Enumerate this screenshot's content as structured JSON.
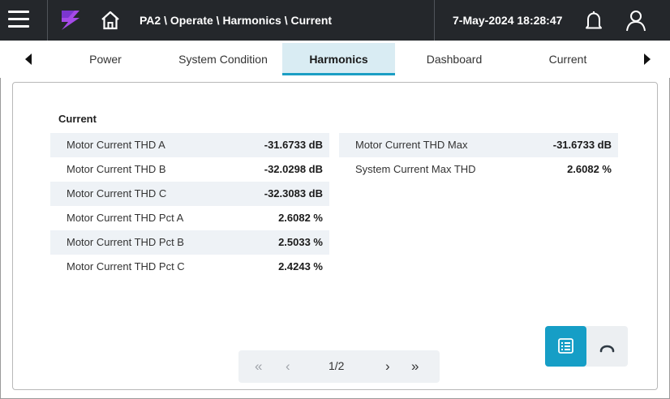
{
  "header": {
    "breadcrumb": "PA2 \\ Operate \\ Harmonics \\ Current",
    "datetime": "7-May-2024 18:28:47",
    "icons": [
      "menu-icon",
      "logo-icon",
      "home-icon",
      "bell-icon",
      "user-icon"
    ],
    "colors": {
      "background": "#24272b",
      "logo": "#a54ae8"
    }
  },
  "tabs": {
    "items": [
      {
        "label": "Power"
      },
      {
        "label": "System Condition"
      },
      {
        "label": "Harmonics"
      },
      {
        "label": "Dashboard"
      },
      {
        "label": "Current"
      }
    ],
    "active": "Harmonics",
    "accent": "#1b9ec4"
  },
  "content": {
    "section_title": "Current",
    "left_rows": [
      {
        "label": "Motor Current THD A",
        "value": "-31.6733 dB"
      },
      {
        "label": "Motor Current THD B",
        "value": "-32.0298 dB"
      },
      {
        "label": "Motor Current THD C",
        "value": "-32.3083 dB"
      },
      {
        "label": "Motor Current THD Pct A",
        "value": "2.6082 %"
      },
      {
        "label": "Motor Current THD Pct B",
        "value": "2.5033 %"
      },
      {
        "label": "Motor Current THD Pct C",
        "value": "2.4243 %"
      }
    ],
    "right_rows": [
      {
        "label": "Motor Current THD Max",
        "value": "-31.6733 dB"
      },
      {
        "label": "System Current Max THD",
        "value": "2.6082 %"
      }
    ]
  },
  "pager": {
    "first": "«",
    "prev": "‹",
    "page": "1/2",
    "next": "›",
    "last": "»"
  },
  "view_toggle": {
    "selected": "list",
    "icons": [
      "list-view-icon",
      "gauge-view-icon"
    ],
    "accent": "#169ec6"
  }
}
